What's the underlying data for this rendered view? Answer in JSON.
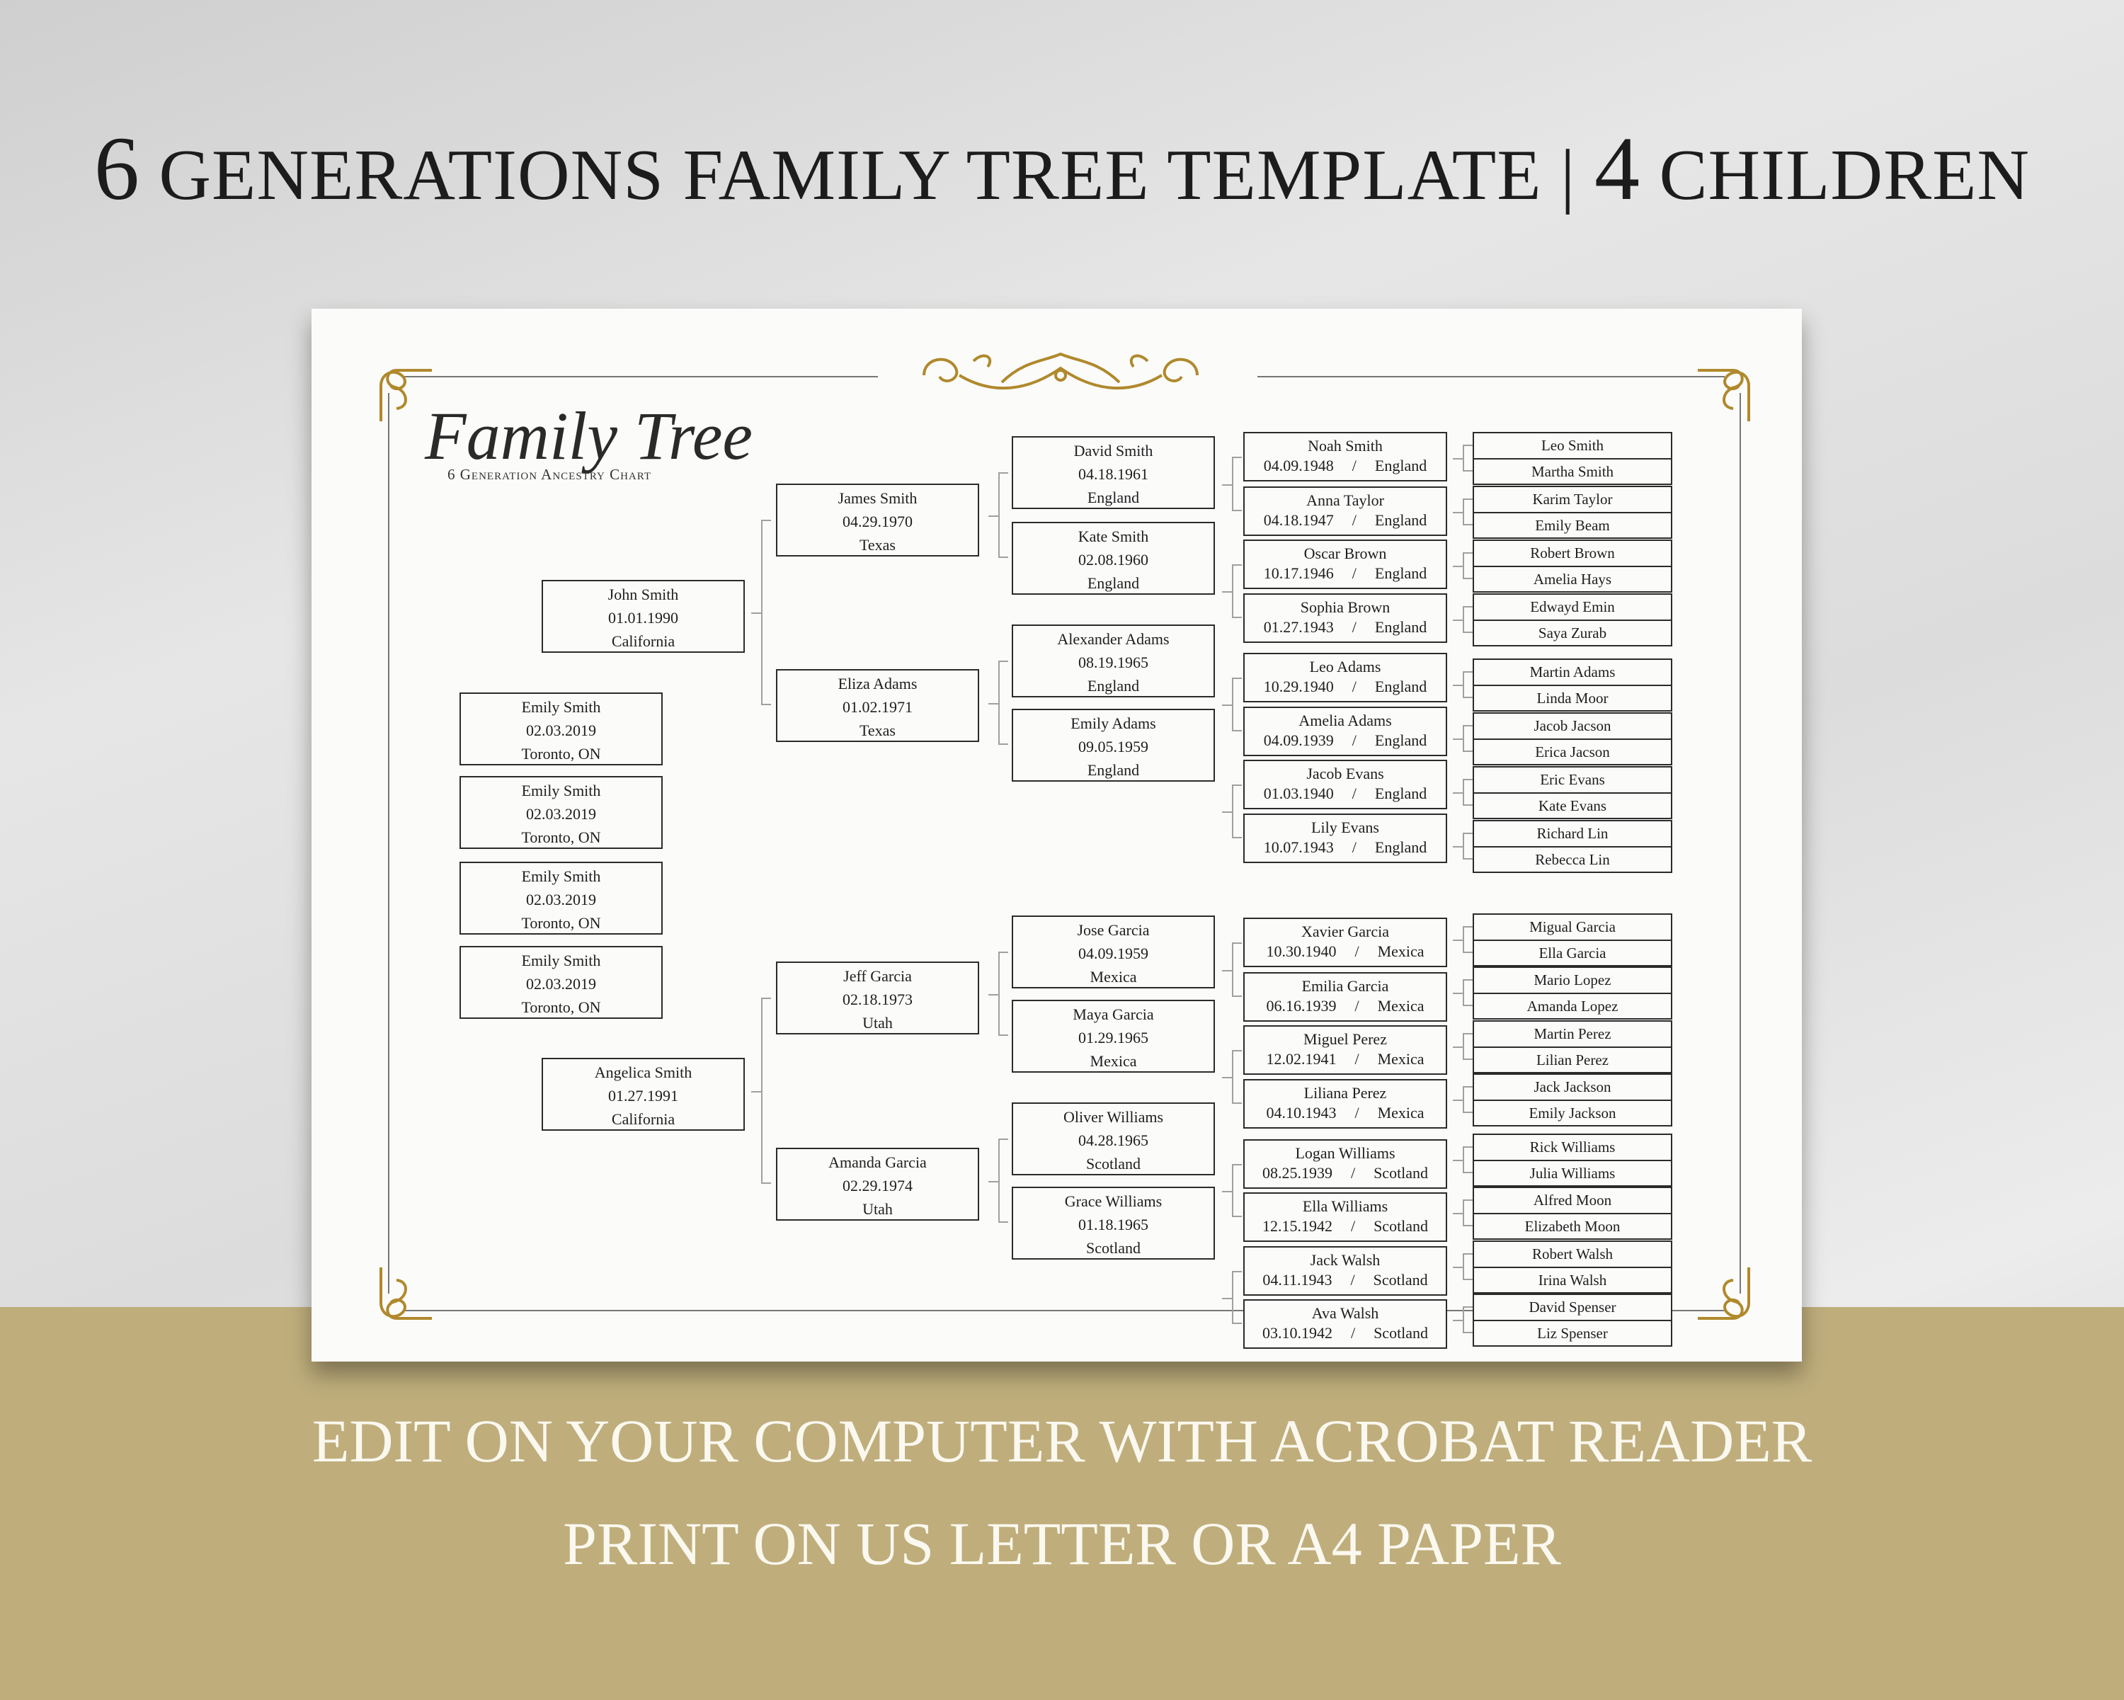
{
  "headline": {
    "num1": "6",
    "part1": "GENERATIONS FAMILY TREE TEMPLATE",
    "sep": "|",
    "num2": "4",
    "part2": "CHILDREN"
  },
  "footer": {
    "line1": "EDIT ON YOUR COMPUTER WITH ACROBAT READER",
    "line2": "PRINT ON US LETTER OR A4 PAPER"
  },
  "logo": {
    "title": "Family Tree",
    "subtitle": "6 Generation Ancestry Chart"
  },
  "colors": {
    "gold": "#b0892c",
    "band": "#bfae7c",
    "box_border": "#2b2b2b"
  },
  "children": [
    {
      "name": "Emily Smith",
      "date": "02.03.2019",
      "place": "Toronto, ON"
    },
    {
      "name": "Emily Smith",
      "date": "02.03.2019",
      "place": "Toronto, ON"
    },
    {
      "name": "Emily Smith",
      "date": "02.03.2019",
      "place": "Toronto, ON"
    },
    {
      "name": "Emily Smith",
      "date": "02.03.2019",
      "place": "Toronto, ON"
    }
  ],
  "parents": [
    {
      "name": "John Smith",
      "date": "01.01.1990",
      "place": "California"
    },
    {
      "name": "Angelica Smith",
      "date": "01.27.1991",
      "place": "California"
    }
  ],
  "grandparents": [
    {
      "name": "James Smith",
      "date": "04.29.1970",
      "place": "Texas"
    },
    {
      "name": "Eliza Adams",
      "date": "01.02.1971",
      "place": "Texas"
    },
    {
      "name": "Jeff Garcia",
      "date": "02.18.1973",
      "place": "Utah"
    },
    {
      "name": "Amanda Garcia",
      "date": "02.29.1974",
      "place": "Utah"
    }
  ],
  "great_grandparents": [
    {
      "name": "David Smith",
      "date": "04.18.1961",
      "place": "England"
    },
    {
      "name": "Kate Smith",
      "date": "02.08.1960",
      "place": "England"
    },
    {
      "name": "Alexander Adams",
      "date": "08.19.1965",
      "place": "England"
    },
    {
      "name": "Emily Adams",
      "date": "09.05.1959",
      "place": "England"
    },
    {
      "name": "Jose Garcia",
      "date": "04.09.1959",
      "place": "Mexica"
    },
    {
      "name": "Maya Garcia",
      "date": "01.29.1965",
      "place": "Mexica"
    },
    {
      "name": "Oliver Williams",
      "date": "04.28.1965",
      "place": "Scotland"
    },
    {
      "name": "Grace Williams",
      "date": "01.18.1965",
      "place": "Scotland"
    }
  ],
  "gen5": [
    {
      "name": "Noah Smith",
      "date": "04.09.1948",
      "place": "England"
    },
    {
      "name": "Anna Taylor",
      "date": "04.18.1947",
      "place": "England"
    },
    {
      "name": "Oscar Brown",
      "date": "10.17.1946",
      "place": "England"
    },
    {
      "name": "Sophia Brown",
      "date": "01.27.1943",
      "place": "England"
    },
    {
      "name": "Leo Adams",
      "date": "10.29.1940",
      "place": "England"
    },
    {
      "name": "Amelia Adams",
      "date": "04.09.1939",
      "place": "England"
    },
    {
      "name": "Jacob Evans",
      "date": "01.03.1940",
      "place": "England"
    },
    {
      "name": "Lily Evans",
      "date": "10.07.1943",
      "place": "England"
    },
    {
      "name": "Xavier Garcia",
      "date": "10.30.1940",
      "place": "Mexica"
    },
    {
      "name": "Emilia Garcia",
      "date": "06.16.1939",
      "place": "Mexica"
    },
    {
      "name": "Miguel Perez",
      "date": "12.02.1941",
      "place": "Mexica"
    },
    {
      "name": "Liliana Perez",
      "date": "04.10.1943",
      "place": "Mexica"
    },
    {
      "name": "Logan Williams",
      "date": "08.25.1939",
      "place": "Scotland"
    },
    {
      "name": "Ella Williams",
      "date": "12.15.1942",
      "place": "Scotland"
    },
    {
      "name": "Jack Walsh",
      "date": "04.11.1943",
      "place": "Scotland"
    },
    {
      "name": "Ava Walsh",
      "date": "03.10.1942",
      "place": "Scotland"
    }
  ],
  "gen5_separator": "/",
  "gen6": [
    [
      "Leo Smith",
      "Martha Smith"
    ],
    [
      "Karim Taylor",
      "Emily Beam"
    ],
    [
      "Robert Brown",
      "Amelia Hays"
    ],
    [
      "Edwayd Emin",
      "Saya Zurab"
    ],
    [
      "Martin Adams",
      "Linda Moor"
    ],
    [
      "Jacob Jacson",
      "Erica Jacson"
    ],
    [
      "Eric Evans",
      "Kate Evans"
    ],
    [
      "Richard Lin",
      "Rebecca Lin"
    ],
    [
      "Migual Garcia",
      "Ella Garcia"
    ],
    [
      "Mario Lopez",
      "Amanda Lopez"
    ],
    [
      "Martin Perez",
      "Lilian Perez"
    ],
    [
      "Jack Jackson",
      "Emily Jackson"
    ],
    [
      "Rick Williams",
      "Julia Williams"
    ],
    [
      "Alfred Moon",
      "Elizabeth Moon"
    ],
    [
      "Robert Walsh",
      "Irina Walsh"
    ],
    [
      "David Spenser",
      "Liz Spenser"
    ]
  ]
}
